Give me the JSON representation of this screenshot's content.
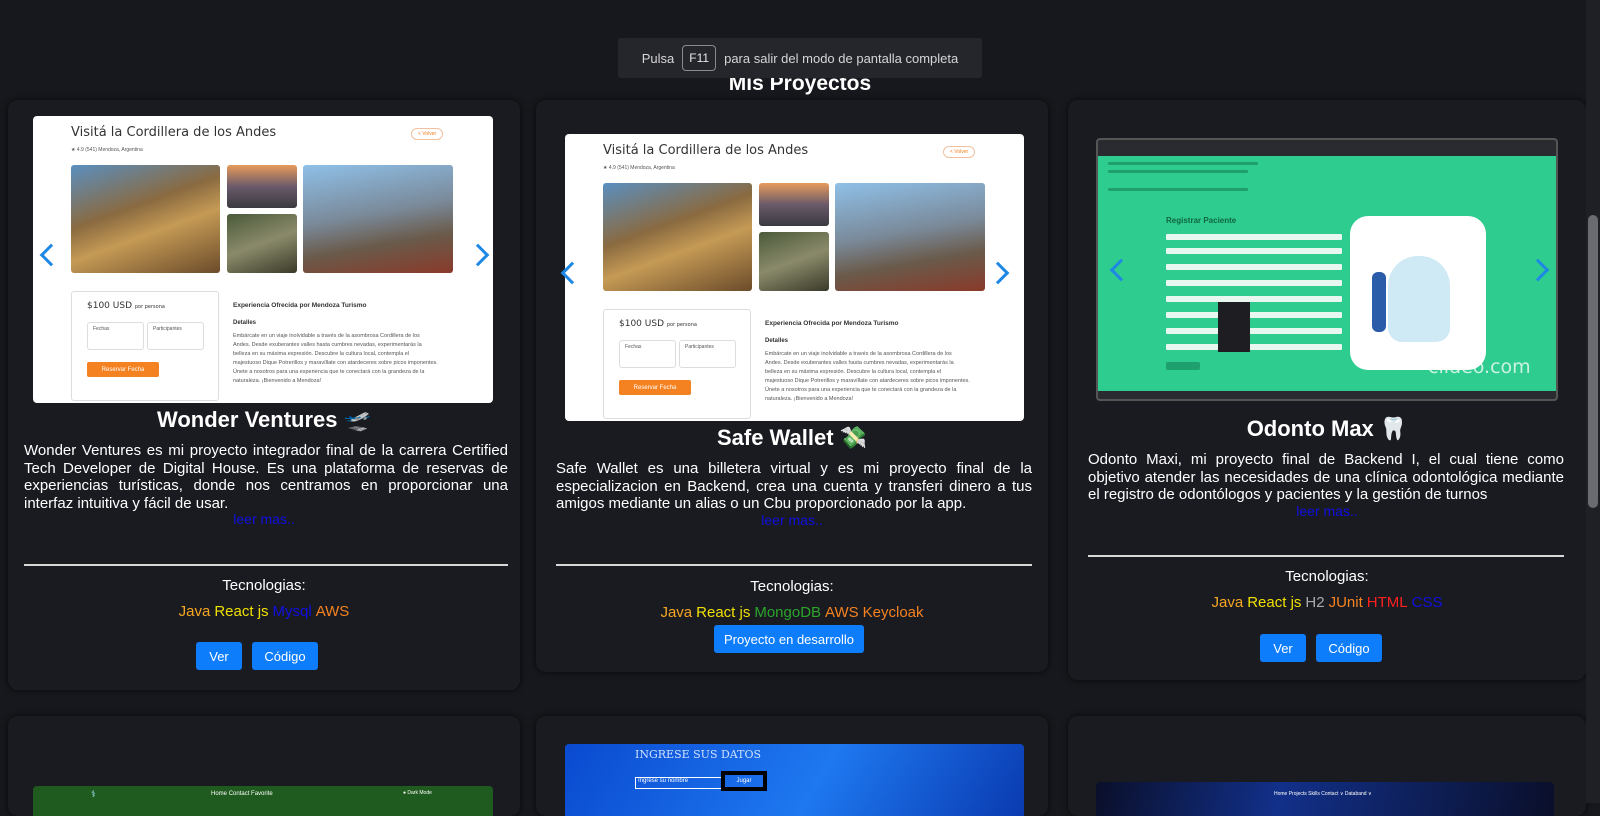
{
  "toast": {
    "prefix": "Pulsa",
    "key": "F11",
    "suffix": "para salir del modo de pantalla completa"
  },
  "section_title": "Mis Proyectos",
  "colors": {
    "accent": "#0d7dfb",
    "java": "#f5a623",
    "react": "#f0e000",
    "mysql": "#1010e0",
    "aws": "#f58220",
    "mongo": "#2aa52a",
    "keycloak": "#f58220",
    "h2": "#aaaaaa",
    "junit": "#f58220",
    "html": "#ff2020",
    "css": "#1010e0",
    "teal": "#2ecc8f"
  },
  "mock": {
    "heading": "Visitá la Cordillera de los Andes",
    "rating": "★ 4.9 (541)  Mendoza, Argentina",
    "back": "< Volver",
    "price": "$100 USD",
    "per": "por persona",
    "fechas": "Fechas",
    "participantes": "Participantes",
    "reserve": "Reservar Fecha",
    "exp_title": "Experiencia Ofrecida por Mendoza Turismo",
    "details": "Detalles",
    "details_text": "Embárcate en un viaje inolvidable a través de la asombrosa Cordillera de los Andes. Desde exuberantes valles hasta cumbres nevadas, experimentarás la belleza en su máxima expresión. Descubre la cultura local, contempla el majestuoso Dique Potrerillos y maravíllate con atardeceres sobre picos imponentes. Únete a nosotros para una experiencia que te conectará con la grandeza de la naturaleza. ¡Bienvenido a Mendoza!",
    "register": "Registrar Paciente",
    "watermark": "clideo.com",
    "ingrese": "INGRESE SUS DATOS",
    "nombre_placeholder": "Ingrese su nombre",
    "jugar": "Jugar",
    "nav_home": "Home",
    "nav_contact": "Contact",
    "nav_favorite": "Favorite",
    "dark_mode": "Dark Mode",
    "nav2": "Home   Projects   Skills   Contact   ∨ Databand ∨"
  },
  "projects": [
    {
      "title": "Wonder Ventures 🛫",
      "desc": "Wonder Ventures es mi proyecto integrador final de la carrera Certified Tech Developer de Digital House. Es una plataforma de reservas de experiencias turísticas, donde nos centramos en proporcionar una interfaz intuitiva y fácil de usar.",
      "more": "leer mas..",
      "tech_label": "Tecnologias:",
      "techs": [
        "Java",
        "React js",
        "Mysql",
        "AWS"
      ],
      "btn_view": "Ver",
      "btn_code": "Código"
    },
    {
      "title": "Safe Wallet 💸",
      "desc": "Safe Wallet es una billetera virtual y es mi proyecto final de la especializacion en Backend, crea una cuenta y transferi dinero a tus amigos mediante un alias o un Cbu proporcionado por la app.",
      "more": "leer mas..",
      "tech_label": "Tecnologias:",
      "techs": [
        "Java",
        "React js",
        "MongoDB",
        "AWS",
        "Keycloak"
      ],
      "btn_dev": "Proyecto en desarrollo"
    },
    {
      "title": "Odonto Max 🦷",
      "desc": "Odonto Maxi, mi proyecto final de Backend I, el cual tiene como objetivo atender las necesidades de una clínica odontológica mediante el registro de odontólogos y pacientes y la gestión de turnos",
      "more": "leer mas..",
      "tech_label": "Tecnologias:",
      "techs": [
        "Java",
        "React js",
        "H2",
        "JUnit",
        "HTML",
        "CSS"
      ],
      "btn_view": "Ver",
      "btn_code": "Código"
    }
  ]
}
